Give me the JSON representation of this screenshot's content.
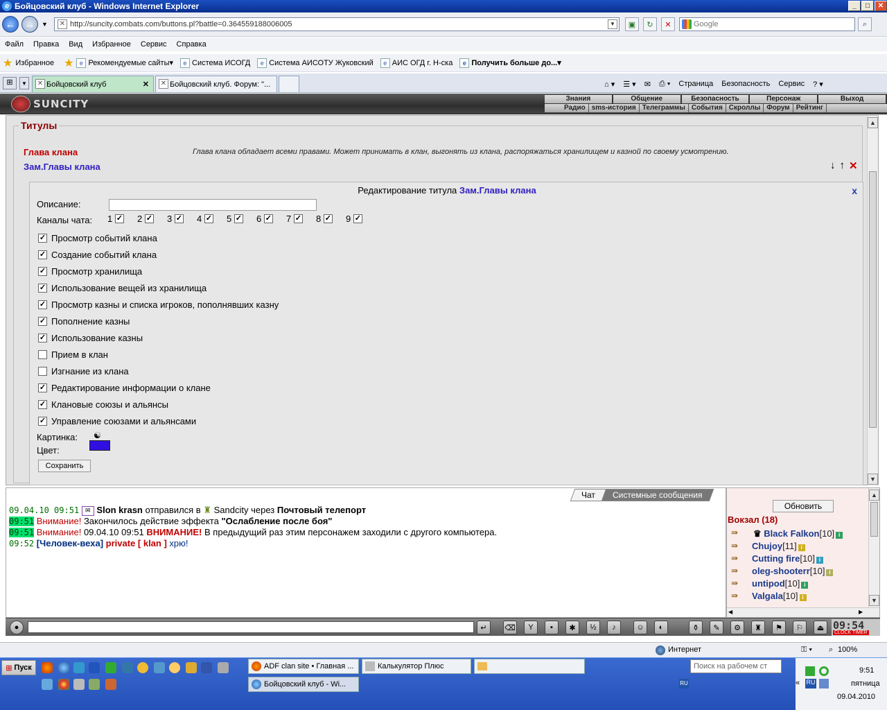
{
  "window": {
    "title": "Бойцовский клуб - Windows Internet Explorer"
  },
  "browser": {
    "url": "http://suncity.combats.com/buttons.pl?battle=0.364559188006005",
    "search_placeholder": "Google",
    "menu": [
      "Файл",
      "Правка",
      "Вид",
      "Избранное",
      "Сервис",
      "Справка"
    ],
    "favorites": [
      "Избранное",
      "Рекомендуемые сайты",
      "Система ИСОГД",
      "Система АИСОТУ Жуковский",
      "АИС ОГД г. Н-ска",
      "Получить больше до..."
    ],
    "tabs": [
      "Бойцовский клуб",
      "Бойцовский клуб. Форум: \"..."
    ],
    "commands": [
      "Страница",
      "Безопасность",
      "Сервис"
    ],
    "status": {
      "zone": "Интернет",
      "zoom": "100%"
    }
  },
  "game": {
    "logo": "SUNCITY",
    "topnav": [
      "Знания",
      "Общение",
      "Безопасность",
      "Персонаж",
      "Выход"
    ],
    "subnav": [
      "Радио",
      "sms-история",
      "Телеграммы",
      "События",
      "Скроллы",
      "Форум",
      "Рейтинг"
    ],
    "titles_legend": "Титулы",
    "rank1": {
      "name": "Глава клана",
      "desc": "Глава клана обладает всеми правами. Может принимать в клан, выгонять из клана, распоряжаться хранилищем и казной по своему усмотрению."
    },
    "rank2": {
      "name": "Зам.Главы клана"
    },
    "edit": {
      "heading": "Редактирование титула",
      "title_name": "Зам.Главы клана",
      "description_label": "Описание:",
      "channels_label": "Каналы чата:",
      "channels": [
        "1",
        "2",
        "3",
        "4",
        "5",
        "6",
        "7",
        "8",
        "9"
      ],
      "permissions": [
        {
          "label": "Просмотр событий клана",
          "checked": true
        },
        {
          "label": "Создание событий клана",
          "checked": true
        },
        {
          "label": "Просмотр хранилища",
          "checked": true
        },
        {
          "label": "Использование вещей из хранилища",
          "checked": true
        },
        {
          "label": "Просмотр казны и списка игроков, пополнявших казну",
          "checked": true
        },
        {
          "label": "Пополнение казны",
          "checked": true
        },
        {
          "label": "Использование казны",
          "checked": true
        },
        {
          "label": "Прием в клан",
          "checked": false
        },
        {
          "label": "Изгнание из клана",
          "checked": false
        },
        {
          "label": "Редактирование информации о клане",
          "checked": true
        },
        {
          "label": "Клановые союзы и альянсы",
          "checked": true
        },
        {
          "label": "Управление союзами и альянсами",
          "checked": true
        }
      ],
      "picture_label": "Картинка:",
      "color_label": "Цвет:",
      "color_value": "#3010e0",
      "save_label": "Сохранить",
      "close_label": "x"
    },
    "chat": {
      "tabs": [
        "Чат",
        "Системные сообщения"
      ],
      "line1": {
        "time": "09.04.10 09:51",
        "user": "Slon krasn",
        "text1": "отправился в",
        "place": "Sandcity",
        "text2": "через",
        "transport": "Почтовый телепорт"
      },
      "line2": {
        "time": "09:51",
        "warn": "Внимание!",
        "text": "Закончилось действие эффекта",
        "effect": "\"Ослабление после боя\""
      },
      "line3": {
        "time": "09:51",
        "warn": "Внимание!",
        "date": "09.04.10 09:51",
        "warn2": "ВНИМАНИЕ!",
        "text": "В предыдущий раз этим персонажем заходили с другого компьютера."
      },
      "line4": {
        "time": "09:52",
        "sender": "[Человек-веха]",
        "channel": "private [ klan ]",
        "text": "хрю!"
      }
    },
    "online": {
      "refresh_label": "Обновить",
      "location": "Вокзал (18)",
      "users": [
        {
          "name": "Black Falkon",
          "level": "[10]"
        },
        {
          "name": "Chujoy",
          "level": "[11]"
        },
        {
          "name": "Cutting fire",
          "level": "[10]"
        },
        {
          "name": "oleg-shooterr",
          "level": "[10]"
        },
        {
          "name": "untipod",
          "level": "[10]"
        },
        {
          "name": "Valgala",
          "level": "[10]"
        }
      ]
    },
    "clock": {
      "time": "09:54",
      "label": "CLOCK TIMER"
    }
  },
  "taskbar": {
    "start_label": "Пуск",
    "tasks": [
      "ADF clan site • Главная ...",
      "Калькулятор Плюс",
      "Бойцовский клуб - Wi..."
    ],
    "search_placeholder": "Поиск на рабочем ст",
    "tray": {
      "time": "9:51",
      "day": "пятница",
      "date": "09.04.2010",
      "lang": "RU"
    }
  }
}
